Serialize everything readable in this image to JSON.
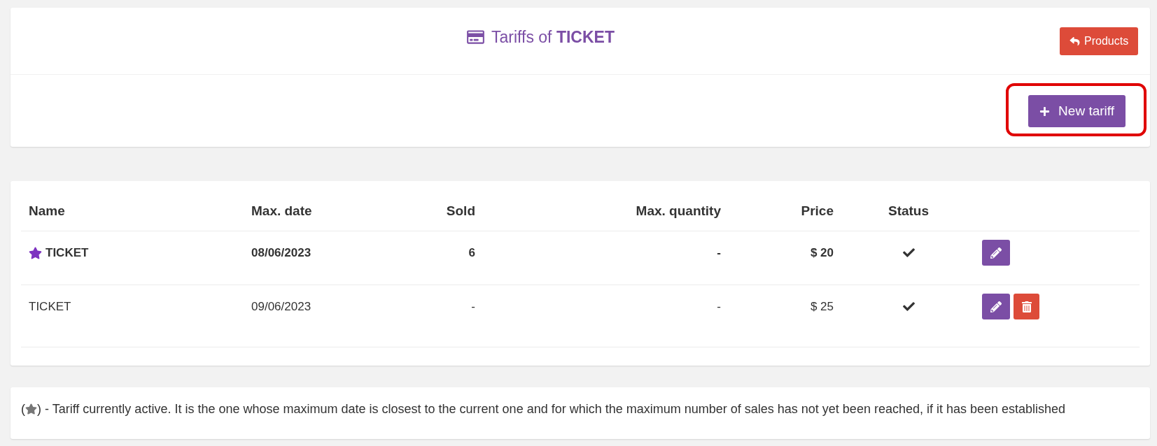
{
  "header": {
    "title": "Tariffs of **TICKET**",
    "back_button": "Products"
  },
  "toolbar": {
    "new_button": {
      "label": "New tariff",
      "highlighted": true
    }
  },
  "table": {
    "columns": [
      "Name",
      "Max. date",
      "Sold",
      "Max. quantity",
      "Price",
      "Status"
    ],
    "rows": [
      {
        "name": "TICKET",
        "current": true,
        "max_date": "08/06/2023",
        "sold": "6",
        "max_quantity": "-",
        "price": "$ 20",
        "active": true,
        "deletable": false
      },
      {
        "name": "TICKET",
        "current": false,
        "max_date": "09/06/2023",
        "sold": "-",
        "max_quantity": "-",
        "price": "$ 25",
        "active": true,
        "deletable": true
      }
    ]
  },
  "legend": {
    "open": "(",
    "close": ")",
    "text": "- Tariff currently active. It is the one whose maximum date is closest to the current one and for which the maximum number of sales has not yet been reached, if it has been established"
  }
}
